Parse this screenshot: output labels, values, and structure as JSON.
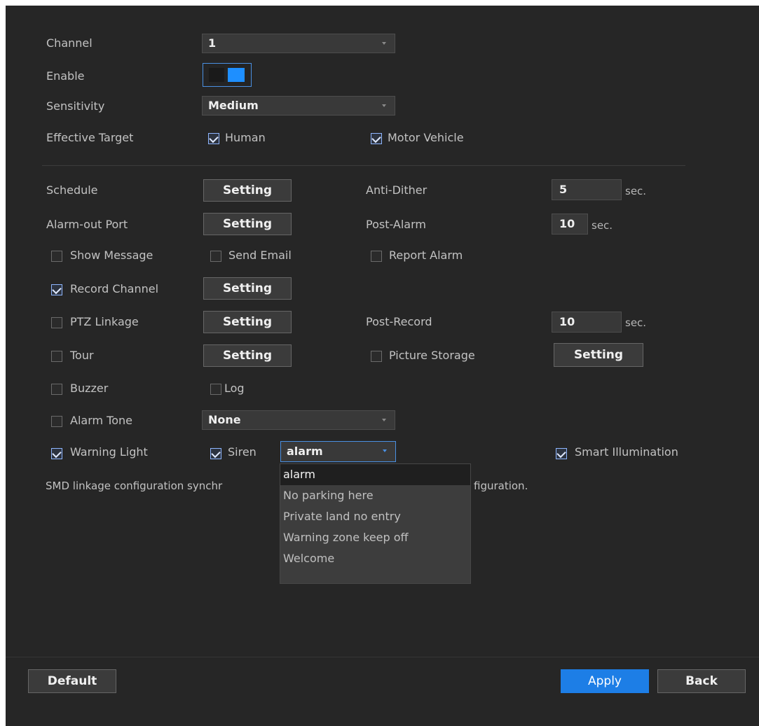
{
  "form": {
    "channel": {
      "label": "Channel",
      "value": "1"
    },
    "enable": {
      "label": "Enable",
      "on": true
    },
    "sensitivity": {
      "label": "Sensitivity",
      "value": "Medium"
    },
    "effective_target": {
      "label": "Effective Target",
      "human": "Human",
      "motor_vehicle": "Motor Vehicle"
    },
    "schedule": {
      "label": "Schedule",
      "button": "Setting"
    },
    "anti_dither": {
      "label": "Anti-Dither",
      "value": "5",
      "unit": "sec."
    },
    "alarm_out_port": {
      "label": "Alarm-out Port",
      "button": "Setting"
    },
    "post_alarm": {
      "label": "Post-Alarm",
      "value": "10",
      "unit": "sec."
    },
    "show_message": "Show Message",
    "send_email": "Send Email",
    "report_alarm": "Report Alarm",
    "record_channel": {
      "label": "Record Channel",
      "button": "Setting"
    },
    "ptz_linkage": {
      "label": "PTZ Linkage",
      "button": "Setting"
    },
    "post_record": {
      "label": "Post-Record",
      "value": "10",
      "unit": "sec."
    },
    "tour": {
      "label": "Tour",
      "button": "Setting"
    },
    "picture_storage": {
      "label": "Picture Storage",
      "button": "Setting"
    },
    "buzzer": "Buzzer",
    "log": "Log",
    "alarm_tone": {
      "label": "Alarm Tone",
      "value": "None"
    },
    "warning_light": "Warning Light",
    "siren": {
      "label": "Siren",
      "value": "alarm"
    },
    "smart_illumination": "Smart Illumination",
    "note_left": "SMD linkage configuration synchr",
    "note_right": "figuration."
  },
  "siren_options": [
    "alarm",
    "No parking here",
    "Private land no entry",
    "Warning zone keep off",
    "Welcome"
  ],
  "footer": {
    "default": "Default",
    "apply": "Apply",
    "back": "Back"
  },
  "colors": {
    "accent": "#1d7ee6",
    "panel_bg": "#262626",
    "toggle": "#1e8fff"
  }
}
